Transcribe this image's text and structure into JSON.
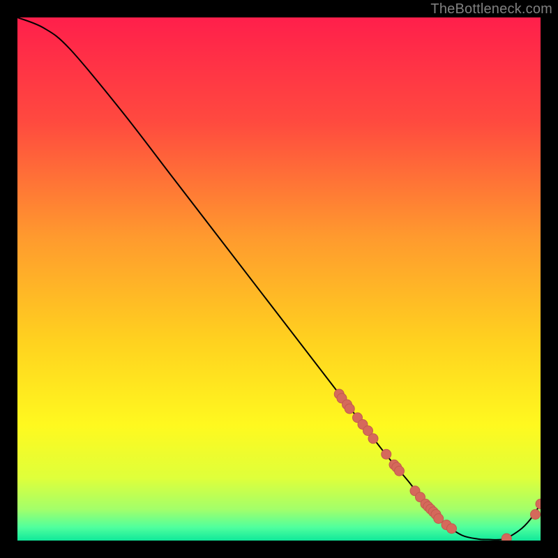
{
  "attribution": "TheBottleneck.com",
  "chart_data": {
    "type": "line",
    "title": "",
    "xlabel": "",
    "ylabel": "",
    "xlim": [
      0,
      100
    ],
    "ylim": [
      0,
      100
    ],
    "curve": {
      "x": [
        0,
        5,
        10,
        20,
        30,
        40,
        50,
        60,
        70,
        75,
        78,
        80,
        82,
        85,
        88,
        90,
        93,
        96,
        98,
        100
      ],
      "y": [
        100,
        98,
        94,
        82,
        69,
        56,
        43,
        30,
        17,
        11,
        7,
        5,
        3,
        1,
        0.3,
        0.2,
        0.3,
        2,
        4,
        7
      ]
    },
    "points": {
      "x": [
        61.5,
        62,
        63,
        63.5,
        65,
        66,
        67,
        68,
        70.5,
        72,
        72.5,
        73,
        76,
        77,
        78,
        78.5,
        79,
        79.5,
        80,
        80.5,
        82,
        83,
        93.5,
        99,
        100
      ],
      "y": [
        28,
        27.2,
        26,
        25.2,
        23.5,
        22.2,
        21,
        19.5,
        16.5,
        14.5,
        14,
        13.3,
        9.5,
        8.3,
        7,
        6.5,
        6,
        5.5,
        5,
        4.2,
        3,
        2.3,
        0.4,
        5,
        7
      ]
    },
    "gradient_stops": [
      {
        "offset": 0.0,
        "color": "#ff1f4b"
      },
      {
        "offset": 0.2,
        "color": "#ff4a3f"
      },
      {
        "offset": 0.42,
        "color": "#ff9a2e"
      },
      {
        "offset": 0.62,
        "color": "#ffd21f"
      },
      {
        "offset": 0.78,
        "color": "#fff91f"
      },
      {
        "offset": 0.88,
        "color": "#dfff3a"
      },
      {
        "offset": 0.94,
        "color": "#a3ff6a"
      },
      {
        "offset": 0.975,
        "color": "#4fff9e"
      },
      {
        "offset": 1.0,
        "color": "#10e89a"
      }
    ],
    "point_style": {
      "radius_px": 7,
      "fill": "#d5695b",
      "stroke": "#c25a4d",
      "stroke_width": 1
    },
    "line_style": {
      "stroke": "#000000",
      "width": 2
    }
  }
}
